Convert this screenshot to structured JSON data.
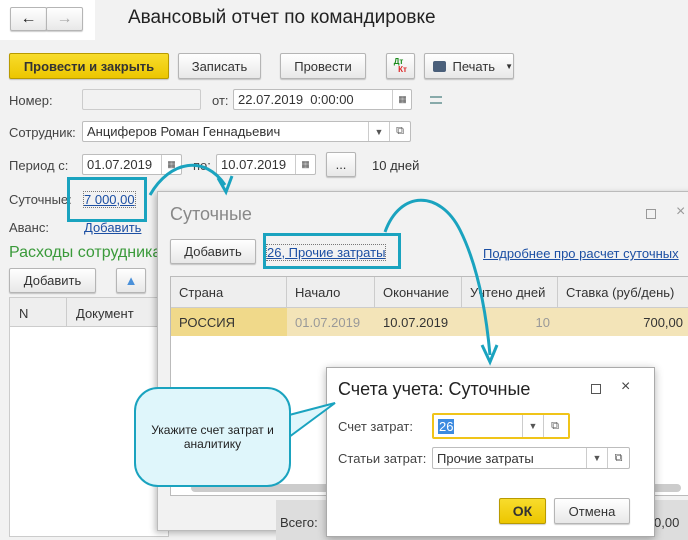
{
  "header": {
    "title": "Авансовый отчет по командировке",
    "back_icon": "arrow-left",
    "forward_icon": "arrow-right"
  },
  "toolbar": {
    "post_close": "Провести и закрыть",
    "save": "Записать",
    "post": "Провести",
    "dtkt_top": "Дт",
    "dtkt_bottom": "Кт",
    "print": "Печать"
  },
  "form": {
    "number_label": "Номер:",
    "number_value": "",
    "date_label": "от:",
    "date_value": "22.07.2019  0:00:00",
    "employee_label": "Сотрудник:",
    "employee_value": "Анциферов Роман Геннадьевич",
    "period_label": "Период с:",
    "period_from": "01.07.2019",
    "period_to_label": "по:",
    "period_to": "10.07.2019",
    "period_btn": "...",
    "days": "10 дней",
    "per_diem_label": "Суточные:",
    "per_diem_value": "7 000,00",
    "advance_label": "Аванс:",
    "advance_link": "Добавить",
    "expenses_title": "Расходы сотрудника",
    "add": "Добавить",
    "columns": [
      "N",
      "Документ"
    ]
  },
  "per_diem_dialog": {
    "title": "Суточные",
    "add": "Добавить",
    "account_link": "26, Прочие затраты",
    "help_link": "Подробнее про расчет суточных",
    "columns": [
      "Страна",
      "Начало",
      "Окончание",
      "Учтено дней",
      "Ставка (руб/день)"
    ],
    "rows": [
      {
        "country": "РОССИЯ",
        "start": "01.07.2019",
        "end": "10.07.2019",
        "days": "10",
        "rate": "700,00"
      }
    ],
    "total_label": "Всего:",
    "total_fragment": "0,00"
  },
  "accounts_dialog": {
    "title": "Счета учета: Суточные",
    "cost_account_label": "Счет затрат:",
    "cost_account_value": "26",
    "cost_item_label": "Статьи затрат:",
    "cost_item_value": "Прочие затраты",
    "ok": "ОК",
    "cancel": "Отмена"
  },
  "callout": {
    "text": "Укажите счет затрат и аналитику"
  },
  "colors": {
    "accent_yellow": "#f0cd0a",
    "highlight_teal": "#1aa3bf",
    "green_title": "#3a9a3a",
    "link": "#1c4fa3",
    "row_selected": "#f3e4a8"
  }
}
